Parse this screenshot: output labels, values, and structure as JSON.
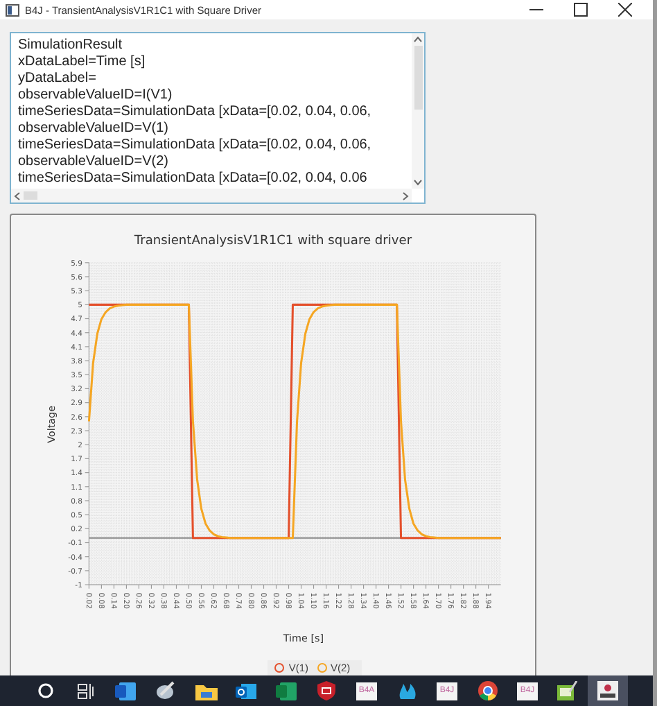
{
  "window": {
    "title": "B4J - TransientAnalysisV1R1C1 with Square Driver"
  },
  "text_area": {
    "lines": [
      "SimulationResult",
      "xDataLabel=Time [s]",
      "yDataLabel=",
      "observableValueID=I(V1)",
      "timeSeriesData=SimulationData [xData=[0.02, 0.04, 0.06,",
      "observableValueID=V(1)",
      "timeSeriesData=SimulationData [xData=[0.02, 0.04, 0.06,",
      "observableValueID=V(2)",
      "timeSeriesData=SimulationData [xData=[0.02, 0.04, 0.06"
    ]
  },
  "chart": {
    "chart_data": {
      "type": "line",
      "grid": true,
      "title": "TransientAnalysisV1R1C1 with square driver",
      "xlabel": "Time [s]",
      "ylabel": "Voltage",
      "x": [
        0.02,
        0.04,
        0.06,
        0.08,
        0.1,
        0.12,
        0.14,
        0.16,
        0.18,
        0.2,
        0.5,
        0.52,
        0.54,
        0.56,
        0.58,
        0.6,
        0.62,
        0.64,
        0.66,
        0.68,
        0.7,
        0.98,
        1.0,
        1.02,
        1.04,
        1.06,
        1.08,
        1.1,
        1.12,
        1.14,
        1.16,
        1.18,
        1.2,
        1.5,
        1.52,
        1.54,
        1.56,
        1.58,
        1.6,
        1.62,
        1.64,
        1.66,
        1.68,
        1.7,
        2.0
      ],
      "series": [
        {
          "name": "V(1)",
          "color": "#e4502c",
          "values": [
            5,
            5,
            5,
            5,
            5,
            5,
            5,
            5,
            5,
            5,
            5,
            0,
            0,
            0,
            0,
            0,
            0,
            0,
            0,
            0,
            0,
            0,
            5,
            5,
            5,
            5,
            5,
            5,
            5,
            5,
            5,
            5,
            5,
            5,
            0,
            0,
            0,
            0,
            0,
            0,
            0,
            0,
            0,
            0,
            0
          ]
        },
        {
          "name": "V(2)",
          "color": "#f5a623",
          "values": [
            2.5,
            3.75,
            4.38,
            4.69,
            4.84,
            4.92,
            4.96,
            4.98,
            4.99,
            5,
            5,
            2.5,
            1.25,
            0.63,
            0.31,
            0.16,
            0.08,
            0.04,
            0.02,
            0.01,
            0,
            0,
            0,
            2.5,
            3.75,
            4.38,
            4.69,
            4.84,
            4.92,
            4.96,
            4.98,
            4.99,
            5,
            5,
            2.5,
            1.25,
            0.63,
            0.31,
            0.16,
            0.08,
            0.04,
            0.02,
            0.01,
            0,
            0
          ]
        }
      ],
      "xlim": [
        0.02,
        2.0
      ],
      "ylim": [
        -1,
        5.9
      ],
      "xticks": [
        {
          "value": 0.02,
          "label": "0.02"
        },
        {
          "value": 0.08,
          "label": "0.08"
        },
        {
          "value": 0.14,
          "label": "0.14"
        },
        {
          "value": 0.2,
          "label": "0.20"
        },
        {
          "value": 0.26,
          "label": "0.26"
        },
        {
          "value": 0.32,
          "label": "0.32"
        },
        {
          "value": 0.38,
          "label": "0.38"
        },
        {
          "value": 0.44,
          "label": "0.44"
        },
        {
          "value": 0.5,
          "label": "0.50"
        },
        {
          "value": 0.56,
          "label": "0.56"
        },
        {
          "value": 0.62,
          "label": "0.62"
        },
        {
          "value": 0.68,
          "label": "0.68"
        },
        {
          "value": 0.74,
          "label": "0.74"
        },
        {
          "value": 0.8,
          "label": "0.80"
        },
        {
          "value": 0.86,
          "label": "0.86"
        },
        {
          "value": 0.92,
          "label": "0.92"
        },
        {
          "value": 0.98,
          "label": "0.98"
        },
        {
          "value": 1.04,
          "label": "1.04"
        },
        {
          "value": 1.1,
          "label": "1.10"
        },
        {
          "value": 1.16,
          "label": "1.16"
        },
        {
          "value": 1.22,
          "label": "1.22"
        },
        {
          "value": 1.28,
          "label": "1.28"
        },
        {
          "value": 1.34,
          "label": "1.34"
        },
        {
          "value": 1.4,
          "label": "1.40"
        },
        {
          "value": 1.46,
          "label": "1.46"
        },
        {
          "value": 1.52,
          "label": "1.52"
        },
        {
          "value": 1.58,
          "label": "1.58"
        },
        {
          "value": 1.64,
          "label": "1.64"
        },
        {
          "value": 1.7,
          "label": "1.70"
        },
        {
          "value": 1.76,
          "label": "1.76"
        },
        {
          "value": 1.82,
          "label": "1.82"
        },
        {
          "value": 1.88,
          "label": "1.88"
        },
        {
          "value": 1.94,
          "label": "1.94"
        }
      ],
      "yticks": [
        5.9,
        5.6,
        5.3,
        5,
        4.7,
        4.4,
        4.1,
        3.8,
        3.5,
        3.2,
        2.9,
        2.6,
        2.3,
        2,
        1.7,
        1.4,
        1.1,
        0.8,
        0.5,
        0.2,
        -0.1,
        -0.4,
        -0.7,
        -1
      ]
    }
  },
  "taskbar": {
    "items": [
      {
        "kind": "search",
        "selected": false
      },
      {
        "kind": "taskview",
        "selected": false
      },
      {
        "kind": "document",
        "selected": false
      },
      {
        "kind": "tool",
        "selected": false
      },
      {
        "kind": "folder",
        "selected": false
      },
      {
        "kind": "mail",
        "selected": false
      },
      {
        "kind": "sheet",
        "selected": false
      },
      {
        "kind": "shield",
        "selected": false
      },
      {
        "kind": "tile",
        "label": "B4A",
        "selected": false
      },
      {
        "kind": "flame",
        "selected": false
      },
      {
        "kind": "tile",
        "label": "B4J",
        "selected": false
      },
      {
        "kind": "browser",
        "selected": false
      },
      {
        "kind": "tile",
        "label": "B4J",
        "selected": false
      },
      {
        "kind": "editor",
        "selected": false
      },
      {
        "kind": "app",
        "selected": true
      }
    ]
  }
}
